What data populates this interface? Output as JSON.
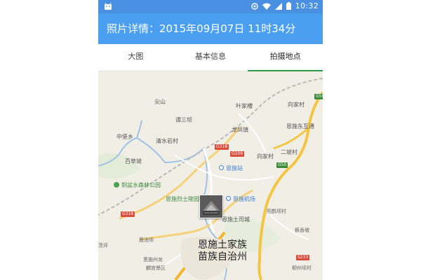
{
  "status_bar": {
    "time": "10:32",
    "icons": [
      "android-icon",
      "sync-icon",
      "wifi-icon",
      "cell-signal-icon",
      "battery-icon"
    ]
  },
  "header": {
    "title": "照片详情：2015年09月07日 11时34分",
    "background": "#4a9ff0"
  },
  "tabs": [
    {
      "label": "大图",
      "active": false
    },
    {
      "label": "基本信息",
      "active": false
    },
    {
      "label": "拍摄地点",
      "active": true
    }
  ],
  "accent_color": "#2e9b4a",
  "map": {
    "place_labels": {
      "jianshan": "尖山",
      "tanxiaba": "谭三坝",
      "yejiacao": "叶家槽",
      "xiangjiacun": "向家村",
      "enshi_east": "恩施东互通",
      "zhongbao": "中堡乡",
      "longfengzhen": "龙凤镇",
      "xiangjiacun2": "向家村",
      "erpocun": "二坡村",
      "qingshuiyan": "清水岩村",
      "baicaopo": "百草坡",
      "enshi_station": "恩施站",
      "park": "铜盆水森林公园",
      "lieshi": "恩施烈士陵园",
      "airport": "恩施机场",
      "tusi": "恩施土司城",
      "yangpingba": "阳鹊坝村",
      "fengxiangpo": "枫香坡",
      "luchiba": "鹿池坝",
      "jing": "茨坪",
      "longlin": "恩施州龙",
      "longlin2": "麟宫景区",
      "liujiaba": "柳州坝村",
      "prefecture_1": "恩施土家族",
      "prefecture_2": "苗族自治州"
    },
    "road_shields": {
      "g50": "G50",
      "g318_a": "G318",
      "g209": "G209",
      "g50_b": "G50",
      "g318_b": "G318",
      "s233": "S233"
    }
  }
}
